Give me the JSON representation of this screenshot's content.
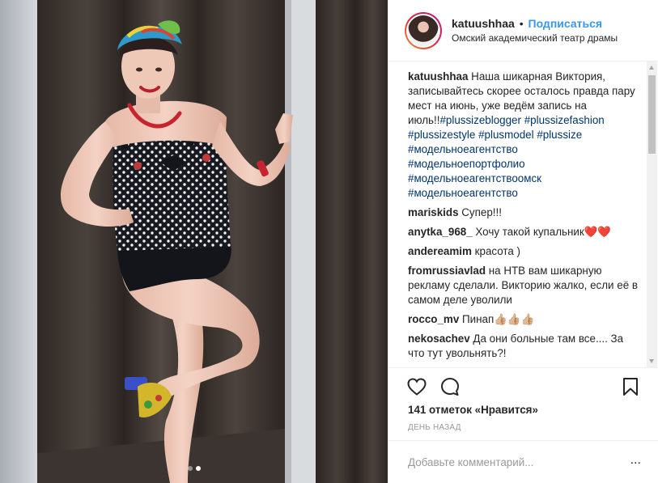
{
  "photo": {
    "carousel": {
      "count": 2,
      "active": 1
    }
  },
  "header": {
    "username": "katuushhaa",
    "separator": "•",
    "follow_label": "Подписаться",
    "location": "Омский академический театр драмы"
  },
  "caption": {
    "username": "katuushhaa",
    "text": "Наша шикарная Виктория, записывайтесь скорее осталось правда пару мест на июнь, уже ведём запись на июль!!",
    "tags": [
      "#plussizeblogger",
      "#plussizefashion",
      "#plussizestyle",
      "#plusmodel",
      "#plussize",
      "#модельноеагентство",
      "#модельноепортфолио",
      "#модельноеагентствоомск",
      "#модельноеагентство"
    ]
  },
  "comments": [
    {
      "user": "mariskids",
      "text": "Супер!!!"
    },
    {
      "user": "anytka_968_",
      "text": "Хочу такой купальник❤️❤️"
    },
    {
      "user": "andereamim",
      "text": "красота )"
    },
    {
      "user": "fromrussiavlad",
      "text": "на НТВ вам шикарную рекламу сделали. Викторию жалко, если её в самом деле уволили"
    },
    {
      "user": "rocco_mv",
      "text": "Пинап👍🏼👍🏼👍🏼"
    },
    {
      "user": "nekosachev",
      "text": "Да они больные там все.... За что тут увольнять?!"
    }
  ],
  "actions": {
    "like_icon": "heart-icon",
    "comment_icon": "comment-icon",
    "save_icon": "bookmark-icon"
  },
  "likes_text": "141 отметок «Нравится»",
  "date_text": "ДЕНЬ НАЗАД",
  "add_comment": {
    "placeholder": "Добавьте комментарий...",
    "more_label": "..."
  },
  "colors": {
    "link": "#3897f0",
    "hashtag": "#003569"
  }
}
